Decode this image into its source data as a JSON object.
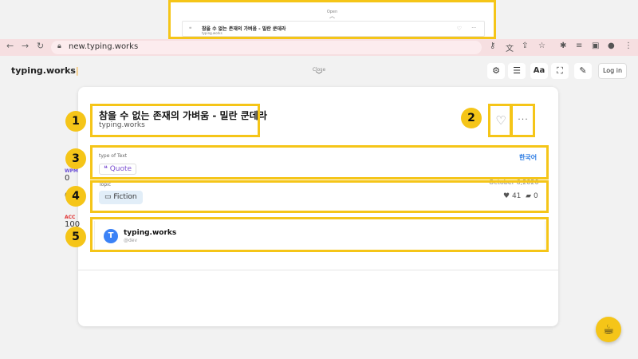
{
  "inset": {
    "open_label": "Open",
    "title": "참을 수 없는 존재의 가벼움 - 밀란 쿤데라",
    "subtitle": "typing.works"
  },
  "browser": {
    "url": "new.typing.works"
  },
  "header": {
    "logo": "typing.works",
    "close_label": "Close",
    "font_button": "Aa",
    "login": "Log in"
  },
  "stats": [
    {
      "label": "WPM",
      "value": "0",
      "color": "#6b4fd8"
    },
    {
      "label": "",
      "value": "0",
      "color": "#2a9d4b"
    },
    {
      "label": "ACC",
      "value": "100",
      "color": "#e03131"
    }
  ],
  "text_card": {
    "title": "참을 수 없는 존재의 가벼움 - 밀란 쿤데라",
    "author": "typing.works",
    "type_label": "type of Text",
    "type_value": "Quote",
    "language": "한국어",
    "topic_label": "Topic",
    "topic_value": "Fiction",
    "date": "October 6,2020",
    "likes": "41",
    "comments": "0",
    "user_name": "typing.works",
    "user_handle": "@dev",
    "avatar_letter": "T"
  },
  "callouts": [
    "1",
    "2",
    "3",
    "4",
    "5"
  ],
  "colors": {
    "highlight": "#f5c518",
    "link": "#2a7ae2",
    "quote": "#7b4fd0"
  }
}
